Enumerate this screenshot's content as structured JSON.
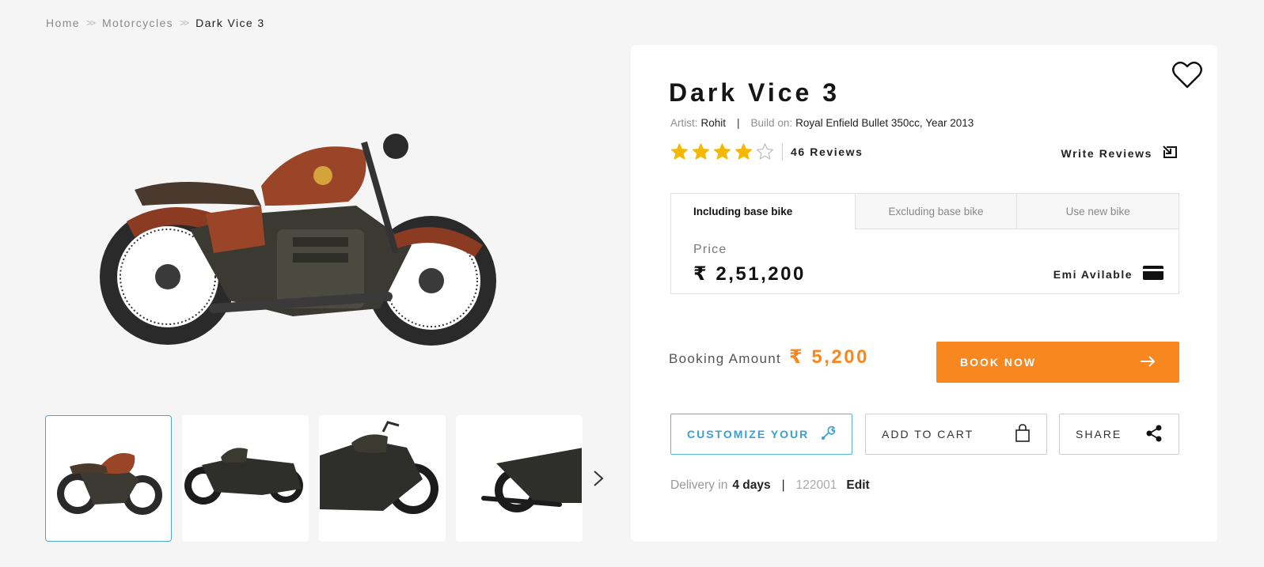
{
  "breadcrumb": {
    "home": "Home",
    "category": "Motorcycles",
    "current": "Dark Vice 3",
    "separator": ">>"
  },
  "product": {
    "title": "Dark Vice 3",
    "artist_label": "Artist:",
    "artist": "Rohit",
    "build_label": "Build on:",
    "build": "Royal Enfield Bullet 350cc, Year 2013",
    "rating": 4,
    "rating_max": 5,
    "reviews": "46 Reviews",
    "write_reviews": "Write Reviews"
  },
  "price_tabs": [
    {
      "label": "Including base bike",
      "active": true
    },
    {
      "label": "Excluding base bike",
      "active": false
    },
    {
      "label": "Use new bike",
      "active": false
    }
  ],
  "price": {
    "label": "Price",
    "value": "₹ 2,51,200",
    "emi": "Emi Avilable"
  },
  "booking": {
    "label": "Booking Amount",
    "value": "₹ 5,200",
    "book_now": "BOOK NOW"
  },
  "actions": {
    "customize": "CUSTOMIZE YOUR",
    "add_to_cart": "ADD TO CART",
    "share": "SHARE"
  },
  "delivery": {
    "label": "Delivery in",
    "days": "4 days",
    "pincode": "122001",
    "edit": "Edit"
  },
  "colors": {
    "accent": "#f7871e",
    "link": "#3a9fd3",
    "star": "#f5b800"
  },
  "icons": [
    "heart-icon",
    "star-icon",
    "external-link-icon",
    "card-icon",
    "arrow-right-icon",
    "wrench-icon",
    "bag-icon",
    "share-icon",
    "chevron-right-icon"
  ]
}
